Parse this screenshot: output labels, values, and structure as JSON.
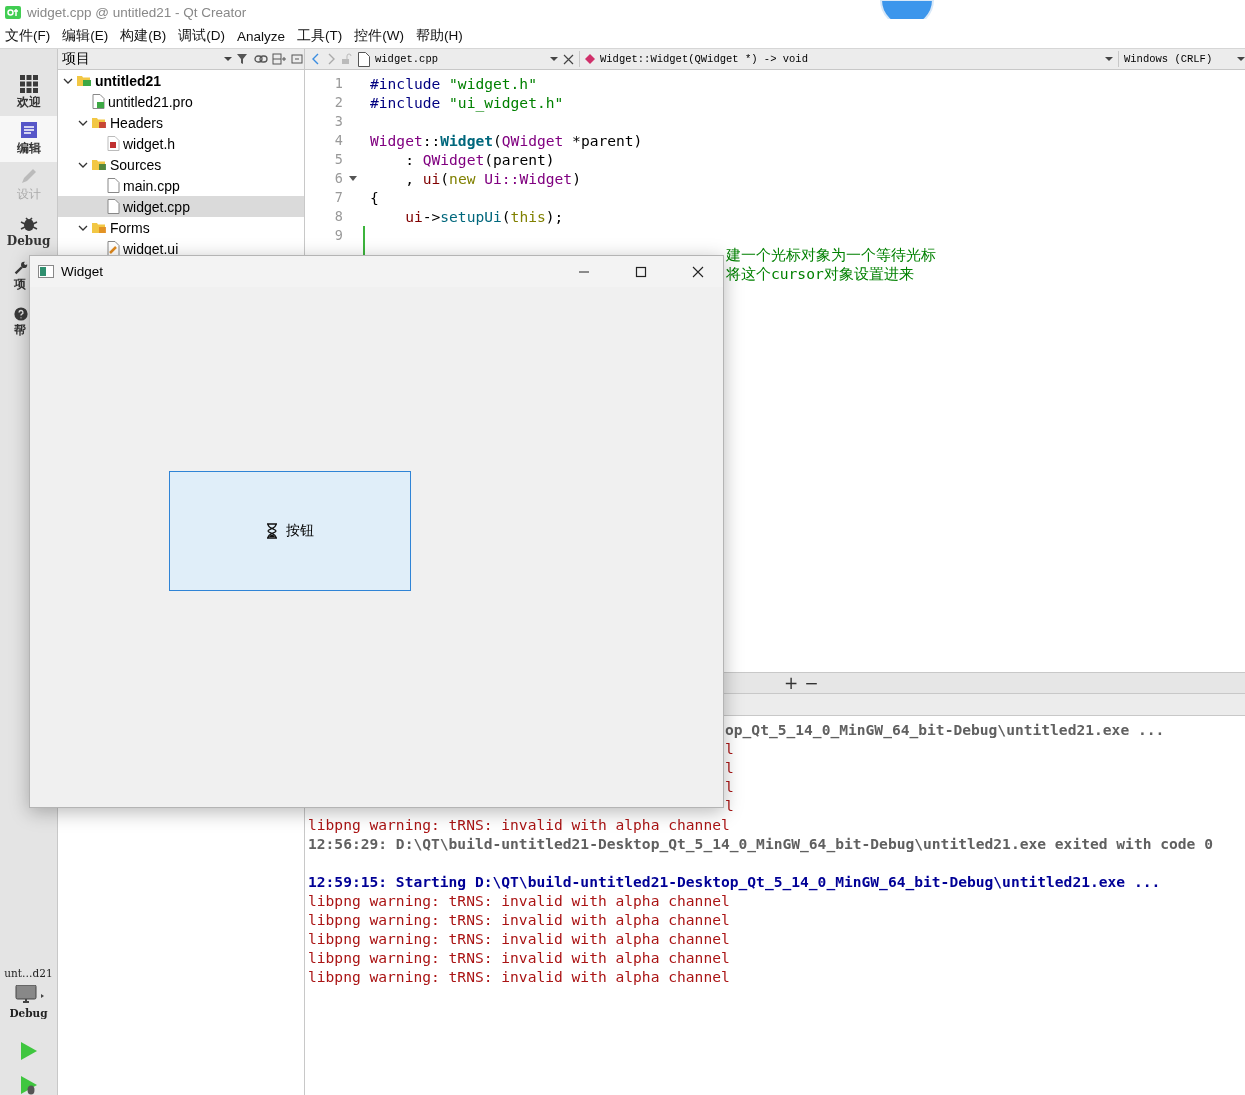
{
  "window": {
    "title": "widget.cpp @ untitled21 - Qt Creator"
  },
  "menu": [
    "文件(F)",
    "编辑(E)",
    "构建(B)",
    "调试(D)",
    "Analyze",
    "工具(T)",
    "控件(W)",
    "帮助(H)"
  ],
  "modes": [
    {
      "label": "欢迎",
      "kind": "grid",
      "selected": false,
      "disabled": false
    },
    {
      "label": "编辑",
      "kind": "edit",
      "selected": true,
      "disabled": false
    },
    {
      "label": "设计",
      "kind": "pencil",
      "selected": false,
      "disabled": true
    },
    {
      "label": "Debug",
      "kind": "bug",
      "selected": false,
      "disabled": false
    },
    {
      "label": "项",
      "kind": "wrench",
      "selected": false,
      "disabled": false,
      "partial": true
    },
    {
      "label": "帮",
      "kind": "help",
      "selected": false,
      "disabled": false,
      "partial": true
    }
  ],
  "kit": {
    "project": "unt…d21",
    "build": "Debug"
  },
  "project_pane": {
    "title": "项目",
    "tree": [
      {
        "label": "untitled21",
        "kind": "project",
        "expanded": true,
        "selected": false,
        "children": [
          {
            "label": "untitled21.pro",
            "kind": "pro",
            "selected": false
          },
          {
            "label": "Headers",
            "kind": "folder-h",
            "expanded": true,
            "selected": false,
            "children": [
              {
                "label": "widget.h",
                "kind": "header",
                "selected": false
              }
            ]
          },
          {
            "label": "Sources",
            "kind": "folder-cpp",
            "expanded": true,
            "selected": false,
            "children": [
              {
                "label": "main.cpp",
                "kind": "source",
                "selected": false
              },
              {
                "label": "widget.cpp",
                "kind": "source",
                "selected": true
              }
            ]
          },
          {
            "label": "Forms",
            "kind": "folder-ui",
            "expanded": true,
            "selected": false,
            "children": [
              {
                "label": "widget.ui",
                "kind": "form",
                "selected": false
              }
            ]
          }
        ]
      }
    ]
  },
  "editor": {
    "file": "widget.cpp",
    "symbol": "Widget::Widget(QWidget *) -> void",
    "encoding": "Windows (CRLF)",
    "lines": [
      {
        "number": "1",
        "tokens": [
          {
            "text": "#include ",
            "kind": "preproc"
          },
          {
            "text": "\"widget.h\"",
            "kind": "string"
          }
        ]
      },
      {
        "number": "2",
        "tokens": [
          {
            "text": "#include ",
            "kind": "preproc"
          },
          {
            "text": "\"ui_widget.h\"",
            "kind": "string"
          }
        ]
      },
      {
        "number": "3"
      },
      {
        "number": "4",
        "tokens": [
          {
            "text": "Widget",
            "kind": "type"
          },
          {
            "text": "::",
            "kind": "plain"
          },
          {
            "text": "Widget",
            "kind": "function-def"
          },
          {
            "text": "(",
            "kind": "plain"
          },
          {
            "text": "QWidget",
            "kind": "type"
          },
          {
            "text": " *parent)",
            "kind": "plain"
          }
        ]
      },
      {
        "number": "5",
        "tokens": [
          {
            "text": "    : ",
            "kind": "plain"
          },
          {
            "text": "QWidget",
            "kind": "type"
          },
          {
            "text": "(parent)",
            "kind": "plain"
          }
        ]
      },
      {
        "number": "6",
        "fold": true,
        "tokens": [
          {
            "text": "    , ",
            "kind": "plain"
          },
          {
            "text": "ui",
            "kind": "member"
          },
          {
            "text": "(",
            "kind": "plain"
          },
          {
            "text": "new ",
            "kind": "keyword"
          },
          {
            "text": "Ui::Widget",
            "kind": "type"
          },
          {
            "text": ")",
            "kind": "plain"
          }
        ]
      },
      {
        "number": "7",
        "tokens": [
          {
            "text": "{",
            "kind": "plain"
          }
        ]
      },
      {
        "number": "8",
        "indented": true,
        "tokens": [
          {
            "text": "ui",
            "kind": "member"
          },
          {
            "text": "->",
            "kind": "plain"
          },
          {
            "text": "setupUi",
            "kind": "function"
          },
          {
            "text": "(",
            "kind": "plain"
          },
          {
            "text": "this",
            "kind": "keyword"
          },
          {
            "text": ");",
            "kind": "plain"
          }
        ]
      },
      {
        "number": "9",
        "changed": true
      },
      {
        "changed": true,
        "partial": true,
        "tokens": [
          {
            "text": "建一个光标对象为一个等待光标",
            "kind": "comment"
          }
        ]
      },
      {
        "partial": true,
        "tokens": [
          {
            "text": "将这个cursor对象设置进来",
            "kind": "comment"
          }
        ]
      }
    ]
  },
  "output": [
    {
      "text": "op_Qt_5_14_0_MinGW_64_bit-Debug\\untitled21.exe ...",
      "kind": "info",
      "partial": true
    },
    {
      "text": "l",
      "kind": "warning",
      "partial": true
    },
    {
      "text": "l",
      "kind": "warning",
      "partial": true
    },
    {
      "text": "l",
      "kind": "warning",
      "partial": true
    },
    {
      "text": "l",
      "kind": "warning",
      "partial": true
    },
    {
      "text": "libpng warning: tRNS: invalid with alpha channel",
      "kind": "warning",
      "partial": false
    },
    {
      "text": "12:56:29: D:\\QT\\build-untitled21-Desktop_Qt_5_14_0_MinGW_64_bit-Debug\\untitled21.exe exited with code 0",
      "kind": "info",
      "partial": false
    },
    {
      "kind": "blank"
    },
    {
      "text": "12:59:15: Starting D:\\QT\\build-untitled21-Desktop_Qt_5_14_0_MinGW_64_bit-Debug\\untitled21.exe ...",
      "kind": "start",
      "partial": false
    },
    {
      "text": "libpng warning: tRNS: invalid with alpha channel",
      "kind": "warning",
      "partial": false
    },
    {
      "text": "libpng warning: tRNS: invalid with alpha channel",
      "kind": "warning",
      "partial": false
    },
    {
      "text": "libpng warning: tRNS: invalid with alpha channel",
      "kind": "warning",
      "partial": false
    },
    {
      "text": "libpng warning: tRNS: invalid with alpha channel",
      "kind": "warning",
      "partial": false
    },
    {
      "text": "libpng warning: tRNS: invalid with alpha channel",
      "kind": "warning",
      "partial": false
    }
  ],
  "split_buttons": [
    "+",
    "−"
  ],
  "widget_window": {
    "title": "Widget",
    "button": {
      "label": "按钮"
    }
  }
}
